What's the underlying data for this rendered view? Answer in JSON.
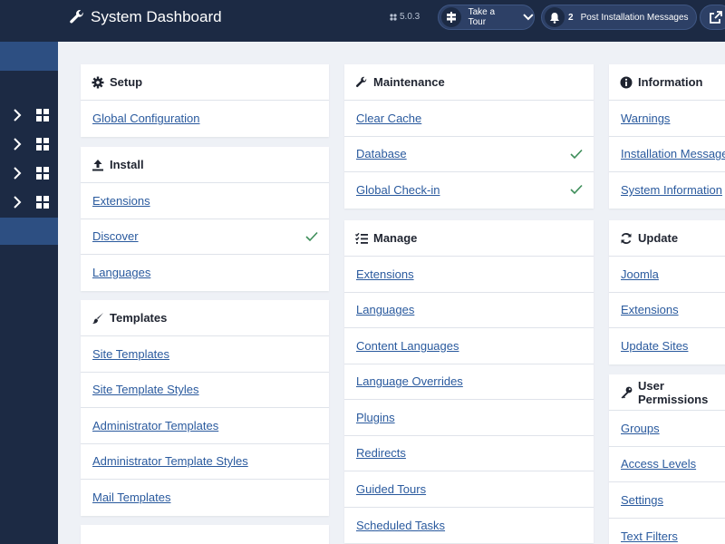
{
  "header": {
    "title": "System Dashboard",
    "title_icon": "wrench-icon",
    "version": "5.0.3",
    "version_icon": "joomla-logo-icon",
    "tour_label": "Take a Tour",
    "post_count": "2",
    "post_label": "Post Installation Messages"
  },
  "sidebar": {
    "rows": [
      {
        "icon": "chevron-right-icon",
        "grid": "dashboard-grid-icon"
      },
      {
        "icon": "chevron-right-icon",
        "grid": "dashboard-grid-icon"
      },
      {
        "icon": "chevron-right-icon",
        "grid": "dashboard-grid-icon"
      },
      {
        "icon": "chevron-right-icon",
        "grid": "dashboard-grid-icon"
      }
    ]
  },
  "columns": {
    "left": {
      "setup": {
        "title": "Setup",
        "icon": "gear-icon",
        "items": [
          "Global Configuration"
        ]
      },
      "install": {
        "title": "Install",
        "icon": "upload-icon",
        "items": [
          "Extensions",
          "Discover",
          "Languages"
        ]
      },
      "templates": {
        "title": "Templates",
        "icon": "brush-icon",
        "items": [
          "Site Templates",
          "Site Template Styles",
          "Administrator Templates",
          "Administrator Template Styles",
          "Mail Templates"
        ]
      }
    },
    "middle": {
      "maintenance": {
        "title": "Maintenance",
        "icon": "wrench-icon",
        "items": [
          "Clear Cache",
          "Database",
          "Global Check-in"
        ]
      },
      "manage": {
        "title": "Manage",
        "icon": "tasks-icon",
        "items": [
          "Extensions",
          "Languages",
          "Content Languages",
          "Language Overrides",
          "Plugins",
          "Redirects",
          "Guided Tours",
          "Scheduled Tasks"
        ]
      }
    },
    "right": {
      "information": {
        "title": "Information",
        "icon": "info-icon",
        "items": [
          "Warnings",
          "Installation Messages",
          "System Information"
        ]
      },
      "update": {
        "title": "Update",
        "icon": "sync-icon",
        "items": [
          "Joomla",
          "Extensions",
          "Update Sites"
        ]
      },
      "permissions": {
        "title": "User Permissions",
        "icon": "key-icon",
        "items": [
          "Groups",
          "Access Levels",
          "Settings",
          "Text Filters"
        ]
      }
    }
  },
  "colors": {
    "sidebar": "#1c2a44",
    "sidebar_active": "#2d4f82",
    "link": "#2a5a9e",
    "check": "#3e8e5a",
    "background": "#eef1f6"
  }
}
